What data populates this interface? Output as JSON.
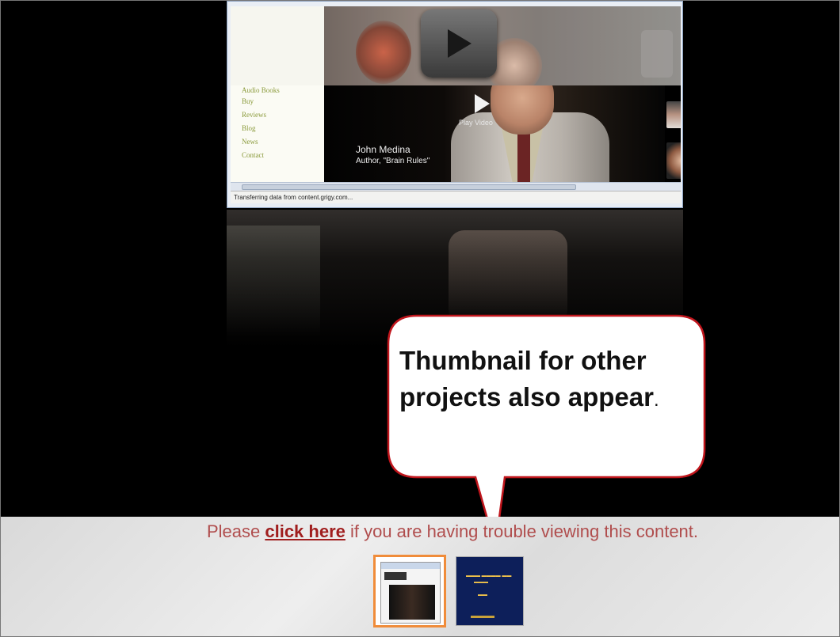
{
  "browser": {
    "menu_items": [
      "Audio Books",
      "Buy",
      "Reviews",
      "Blog",
      "News",
      "Contact"
    ],
    "video": {
      "play_label": "Play Video",
      "speaker_name": "John Medina",
      "speaker_title": "Author, \"Brain Rules\""
    },
    "status_text": "Transferring data from content.grigy.com..."
  },
  "callout": {
    "text": "Thumbnail for other projects also appear",
    "end_mark": "."
  },
  "notice": {
    "prefix": "Please ",
    "link": "click here",
    "suffix": " if you are having trouble viewing this content."
  },
  "thumbnails": [
    {
      "label": "brain-rules-video-project",
      "selected": true
    },
    {
      "label": "dark-blue-project",
      "selected": false
    }
  ],
  "colors": {
    "callout_border": "#c0121b",
    "selected_thumb_border": "#f08c3a",
    "notice_text": "#b04d4d"
  }
}
